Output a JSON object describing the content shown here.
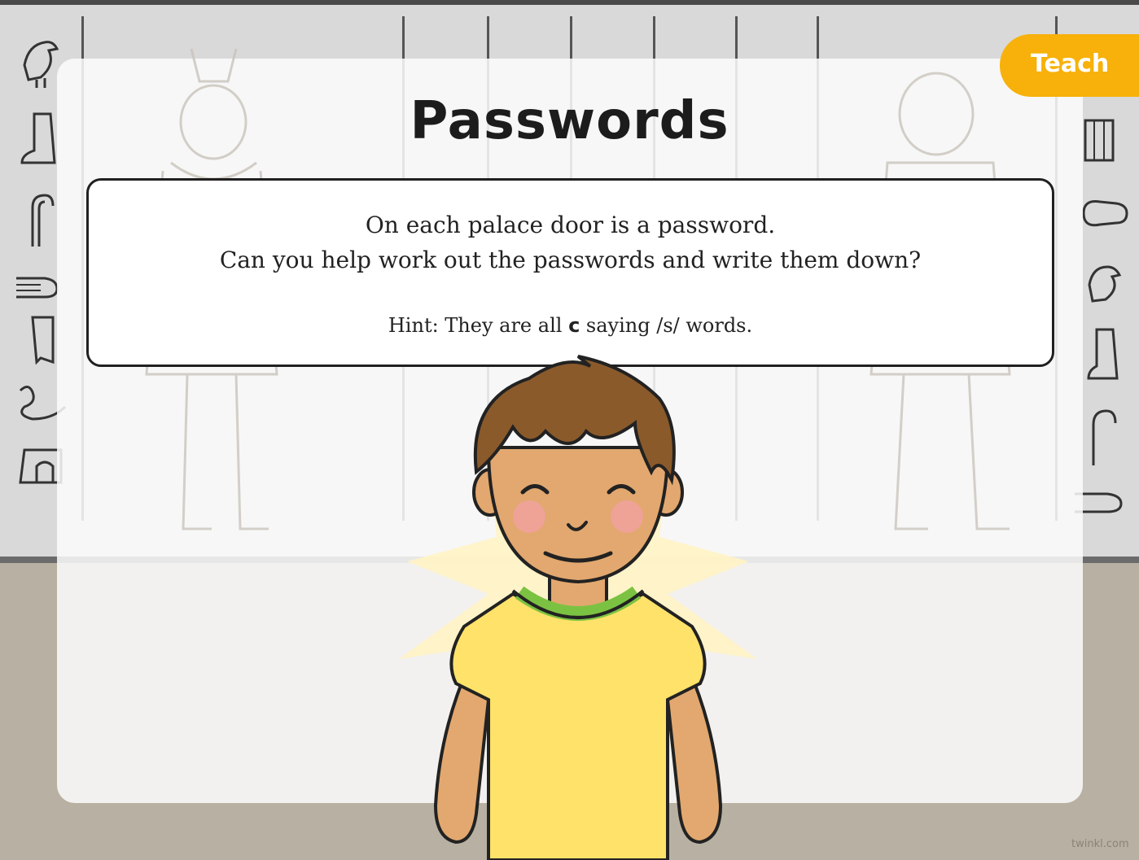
{
  "slide": {
    "title": "Passwords",
    "instructions": {
      "line1": "On each palace door is a password.",
      "line2": "Can you help work out the passwords and write them down?",
      "hint_prefix": "Hint: They are all ",
      "hint_letter": "c",
      "hint_suffix": " saying /s/ words."
    },
    "badge": "Teach",
    "watermark": "twinkl.com"
  },
  "illustration": {
    "subject": "smiling boy in yellow t-shirt",
    "background": "egyptian hieroglyph wall"
  },
  "colors": {
    "badge": "#f7b10a",
    "shirt": "#ffe26a",
    "collar": "#7cc242",
    "hair": "#8b5a2b",
    "skin": "#e2a86f"
  }
}
